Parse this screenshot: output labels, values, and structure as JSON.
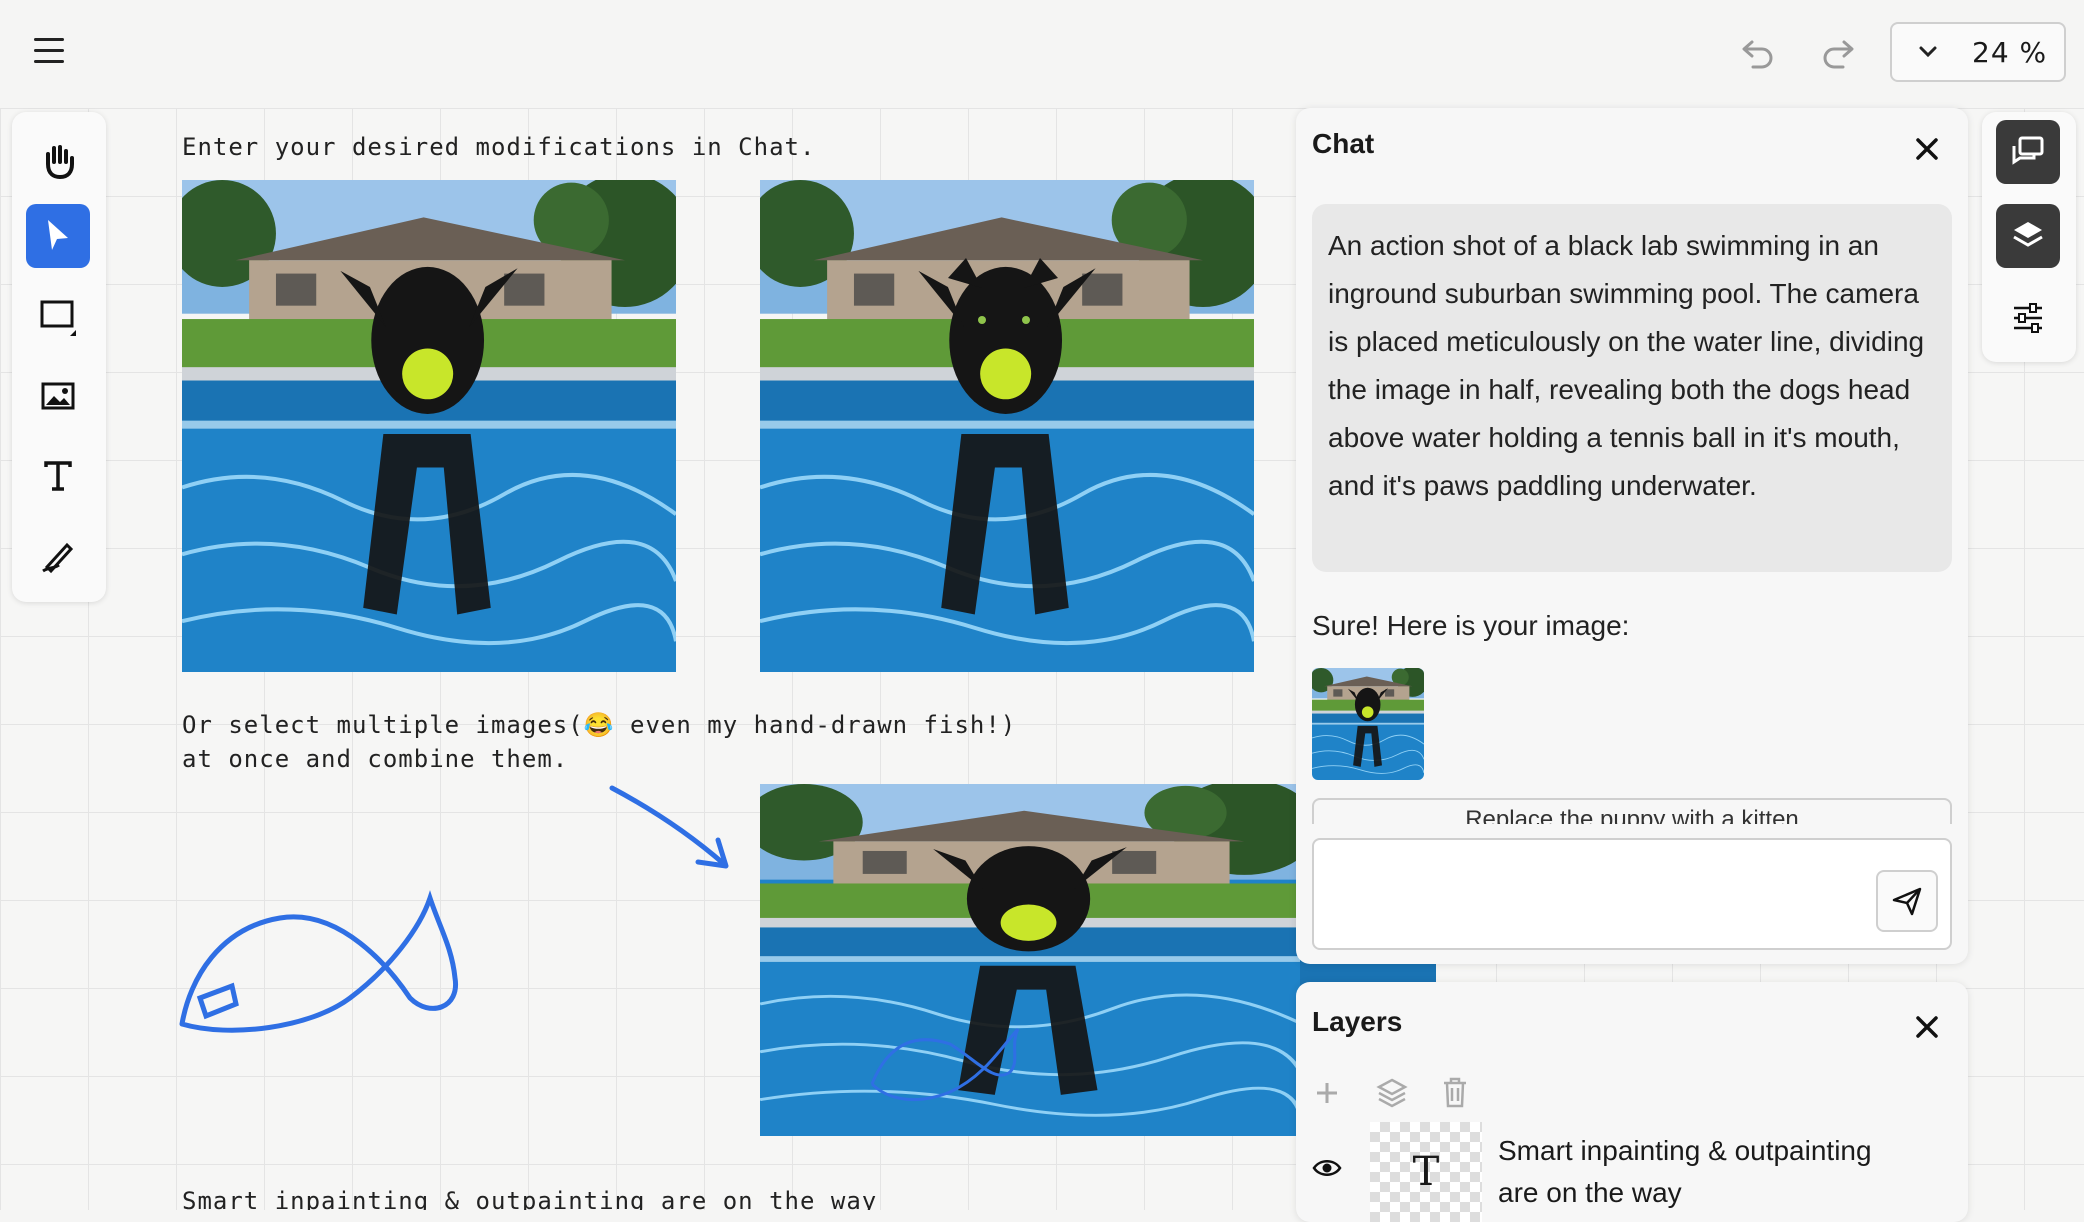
{
  "toolbar": {
    "menu_icon": "hamburger-icon",
    "undo_icon": "undo-icon",
    "redo_icon": "redo-icon",
    "zoom_value": "24 %"
  },
  "tools": [
    "hand-icon",
    "pointer-icon",
    "rectangle-icon",
    "image-icon",
    "text-icon",
    "pen-icon"
  ],
  "canvas": {
    "note1": "Enter your desired modifications in Chat.",
    "note2_line1": "Or select multiple images(😂 even my hand-drawn fish!)",
    "note2_line2": "at once and combine them.",
    "note3": "Smart inpainting & outpainting are on the way"
  },
  "chat": {
    "title": "Chat",
    "prompt": "An action shot of a black lab swimming in an inground suburban swimming pool. The camera is placed meticulously on the water line, dividing the image in half, revealing both the dogs head above water holding a tennis ball in it's mouth, and it's paws paddling underwater.",
    "reply": "Sure! Here is your image:",
    "suggestion": "Replace the puppy with a kitten",
    "input_value": ""
  },
  "layers": {
    "title": "Layers",
    "items": [
      {
        "name": "Smart inpainting & outpainting are on the way",
        "type_icon": "T"
      }
    ]
  },
  "right_toolbar": [
    "chat-icon",
    "layers-icon",
    "sliders-icon"
  ],
  "colors": {
    "accent": "#2f6fe4",
    "fish": "#2f6fe4",
    "pool": "#1c79c0",
    "dark_button": "#3a3a3a"
  }
}
